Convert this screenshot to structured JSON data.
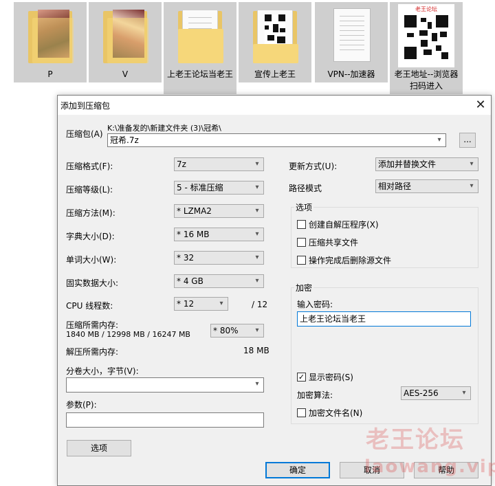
{
  "explorer": {
    "files": [
      {
        "label": "P",
        "kind": "folder-photo-p"
      },
      {
        "label": "V",
        "kind": "folder-photo-v"
      },
      {
        "label": "上老王论坛当老王",
        "kind": "document"
      },
      {
        "label": "宣传上老王",
        "kind": "qr-document"
      },
      {
        "label": "VPN--加速器",
        "kind": "document"
      },
      {
        "label": "老王地址--浏览器扫码进入",
        "kind": "qr-image",
        "image_title": "老王论坛"
      }
    ]
  },
  "dialog": {
    "title": "添加到压缩包",
    "archive": {
      "label": "压缩包(A)",
      "path": "K:\\准备发的\\新建文件夹 (3)\\冠希\\",
      "name": "冠希.7z",
      "browse_label": "..."
    },
    "left": {
      "format": {
        "label": "压缩格式(F):",
        "value": "7z"
      },
      "level": {
        "label": "压缩等级(L):",
        "value": "5 - 标准压缩"
      },
      "method": {
        "label": "压缩方法(M):",
        "value": "* LZMA2"
      },
      "dict": {
        "label": "字典大小(D):",
        "value": "* 16 MB"
      },
      "word": {
        "label": "单词大小(W):",
        "value": "* 32"
      },
      "solid": {
        "label": "固实数据大小:",
        "value": "* 4 GB"
      },
      "cpu": {
        "label": "CPU 线程数:",
        "value": "* 12",
        "max": "/ 12"
      },
      "memory": {
        "label": "压缩所需内存:",
        "detail": "1840 MB / 12998 MB / 16247 MB",
        "value": "* 80%"
      },
      "decomp": {
        "label": "解压所需内存:",
        "value": "18 MB"
      },
      "volume": {
        "label": "分卷大小，字节(V):",
        "value": ""
      },
      "params": {
        "label": "参数(P):",
        "value": ""
      },
      "options_button": "选项"
    },
    "right": {
      "update": {
        "label": "更新方式(U):",
        "value": "添加并替换文件"
      },
      "path_mode": {
        "label": "路径模式",
        "value": "相对路径"
      },
      "options": {
        "title": "选项",
        "sfx": {
          "label": "创建自解压程序(X)",
          "checked": false
        },
        "shared": {
          "label": "压缩共享文件",
          "checked": false
        },
        "delete": {
          "label": "操作完成后删除源文件",
          "checked": false
        }
      },
      "encryption": {
        "title": "加密",
        "password_label": "输入密码:",
        "password": "上老王论坛当老王",
        "show_password": {
          "label": "显示密码(S)",
          "checked": true
        },
        "method_label": "加密算法:",
        "method_value": "AES-256",
        "encrypt_names": {
          "label": "加密文件名(N)",
          "checked": false
        }
      }
    },
    "buttons": {
      "ok": "确定",
      "cancel": "取消",
      "help": "帮助"
    }
  },
  "watermark": {
    "line1": "老王论坛",
    "line2": "laowang.vip"
  }
}
